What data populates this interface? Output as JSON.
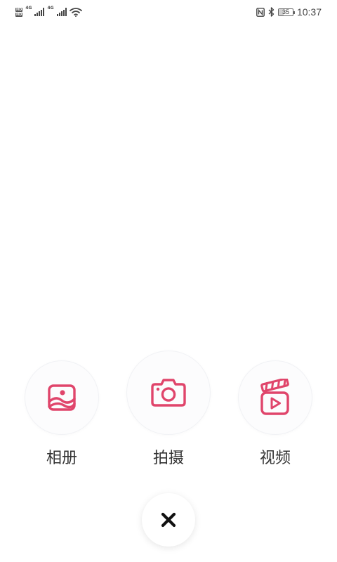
{
  "status_bar": {
    "network_left": "4G",
    "network_right": "4G",
    "battery": "35",
    "battery_level": 0.35,
    "time": "10:37",
    "icons": [
      "hd-icon",
      "signal-icon",
      "wifi-icon",
      "nfc-icon",
      "bluetooth-icon",
      "battery-icon"
    ]
  },
  "options": [
    {
      "label": "相册",
      "icon": "album-icon"
    },
    {
      "label": "拍摄",
      "icon": "camera-icon"
    },
    {
      "label": "视频",
      "icon": "video-icon"
    }
  ],
  "close": {
    "icon": "close-icon"
  },
  "colors": {
    "accent": "#e0456b",
    "label": "#333333",
    "circle_bg": "#fcfcfd",
    "close_icon": "#111111"
  }
}
